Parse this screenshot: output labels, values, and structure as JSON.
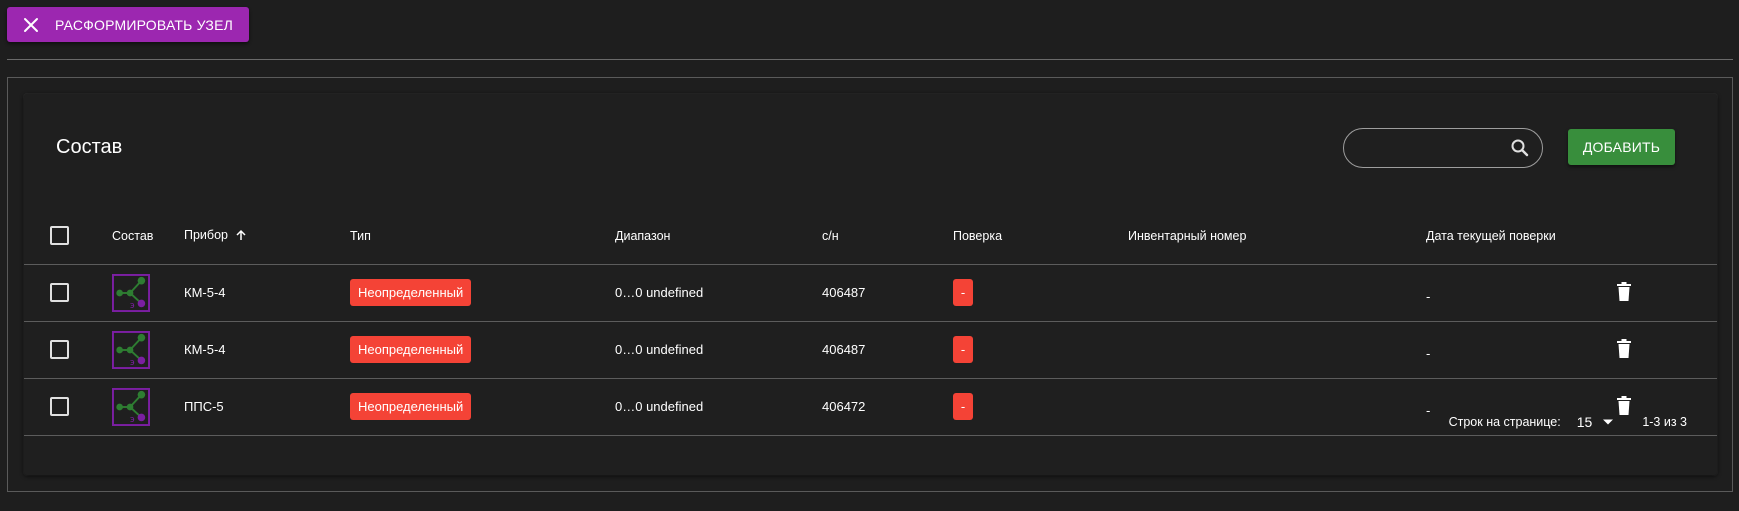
{
  "toolbar": {
    "disband_label": "РАСФОРМИРОВАТЬ УЗЕЛ",
    "accent_color": "#9c27b0"
  },
  "card": {
    "title": "Состав",
    "search": {
      "value": "",
      "placeholder": ""
    },
    "add_label": "ДОБАВИТЬ"
  },
  "table": {
    "headers": {
      "composition": "Состав",
      "device": "Прибор",
      "type": "Тип",
      "range": "Диапазон",
      "serial": "с/н",
      "verification": "Поверка",
      "inventory": "Инвентарный номер",
      "current_verification_date": "Дата текущей поверки"
    },
    "sort": {
      "column": "device",
      "direction": "asc",
      "icon": "arrow-up-icon"
    },
    "rows": [
      {
        "device": "КМ-5-4",
        "type": "Неопределенный",
        "range": "0…0 undefined",
        "serial": "406487",
        "verification": "-",
        "inventory": "",
        "date": "-"
      },
      {
        "device": "КМ-5-4",
        "type": "Неопределенный",
        "range": "0…0 undefined",
        "serial": "406487",
        "verification": "-",
        "inventory": "",
        "date": "-"
      },
      {
        "device": "ППС-5",
        "type": "Неопределенный",
        "range": "0…0 undefined",
        "serial": "406472",
        "verification": "-",
        "inventory": "",
        "date": "-"
      }
    ]
  },
  "pagination": {
    "rows_per_page_label": "Строк на странице:",
    "rows_per_page": "15",
    "range_text": "1-3 из 3"
  },
  "colors": {
    "add_button": "#388e3c",
    "chip_red": "#f44336",
    "node_icon_green": "#2e7d32",
    "node_icon_purple": "#7b1fa2"
  }
}
